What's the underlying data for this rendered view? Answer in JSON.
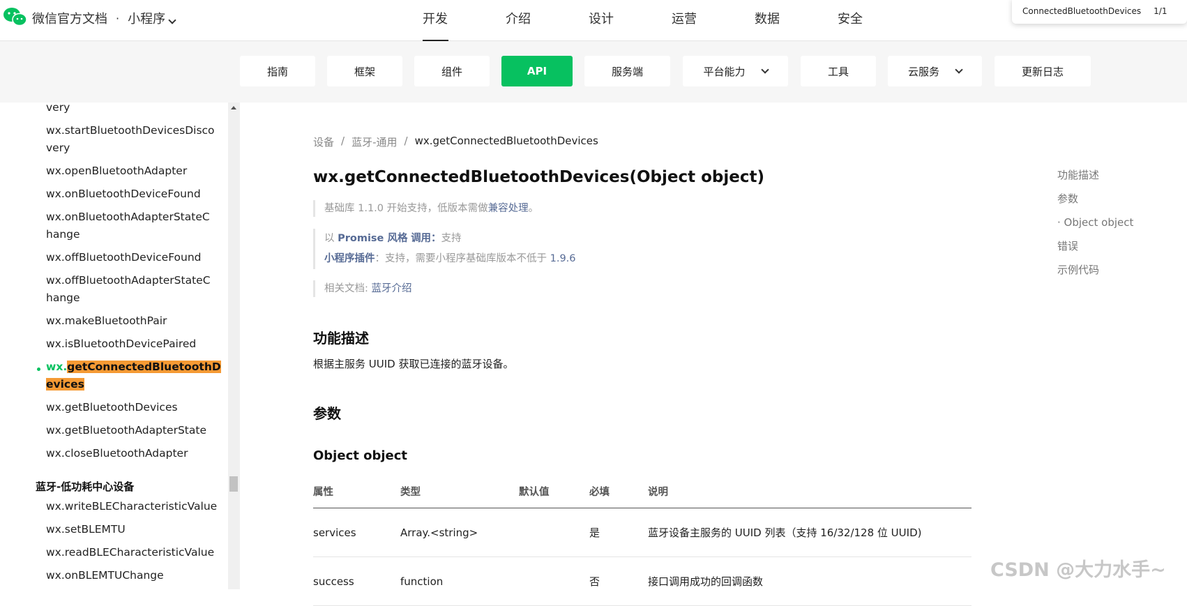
{
  "header": {
    "brand_title": "微信官方文档",
    "brand_dot": "·",
    "brand_sub": "小程序",
    "nav": [
      "开发",
      "介绍",
      "设计",
      "运营",
      "数据",
      "安全"
    ],
    "active_nav": "开发",
    "find": {
      "query": "ConnectedBluetoothDevices",
      "count": "1/1"
    }
  },
  "subnav": {
    "tabs": [
      "指南",
      "框架",
      "组件",
      "API",
      "服务端",
      "平台能力",
      "工具",
      "云服务",
      "更新日志"
    ],
    "active": "API"
  },
  "sidebar": {
    "items": [
      "very",
      "wx.startBluetoothDevicesDisco",
      "very",
      "wx.openBluetoothAdapter",
      "wx.onBluetoothDeviceFound",
      "wx.onBluetoothAdapterStateC",
      "hange",
      "wx.offBluetoothDeviceFound",
      "wx.offBluetoothAdapterStateC",
      "hange",
      "wx.makeBluetoothPair",
      "wx.isBluetoothDevicePaired",
      "wx.getBluetoothDevices",
      "wx.getBluetoothAdapterState",
      "wx.closeBluetoothAdapter"
    ],
    "active_prefix": "wx.",
    "active_hl_1": "getConnectedBluetoothD",
    "active_hl_2": "evices",
    "group_title": "蓝牙-低功耗中心设备",
    "group_items": [
      "wx.writeBLECharacteristicValue",
      "wx.setBLEMTU",
      "wx.readBLECharacteristicValue",
      "wx.onBLEMTUChange"
    ]
  },
  "breadcrumb": [
    "设备",
    "蓝牙-通用",
    "wx.getConnectedBluetoothDevices"
  ],
  "page_title": "wx.getConnectedBluetoothDevices(Object object)",
  "notes": {
    "support_prefix": "基础库 1.1.0 开始支持，低版本需做",
    "support_link": "兼容处理",
    "support_suffix": "。",
    "promise_prefix": "以",
    "promise_link": "Promise 风格",
    "promise_mid": "调用：",
    "promise_value": "支持",
    "plugin_label": "小程序插件",
    "plugin_text": "：支持，需要小程序基础库版本不低于",
    "plugin_version": "1.9.6",
    "related_label": "相关文档: ",
    "related_link": "蓝牙介绍"
  },
  "section_desc_title": "功能描述",
  "section_desc_text": "根据主服务 UUID 获取已连接的蓝牙设备。",
  "section_params_title": "参数",
  "object_title": "Object object",
  "table": {
    "headers": [
      "属性",
      "类型",
      "默认值",
      "必填",
      "说明"
    ],
    "rows": [
      [
        "services",
        "Array.<string>",
        "",
        "是",
        "蓝牙设备主服务的 UUID 列表（支持 16/32/128 位 UUID)"
      ],
      [
        "success",
        "function",
        "",
        "否",
        "接口调用成功的回调函数"
      ]
    ]
  },
  "toc": [
    "功能描述",
    "参数",
    "· Object object",
    "错误",
    "示例代码"
  ],
  "watermark": "CSDN @大力水手~",
  "colors": {
    "accent": "#07c160",
    "link": "#576b95",
    "highlight": "#f59a34"
  }
}
